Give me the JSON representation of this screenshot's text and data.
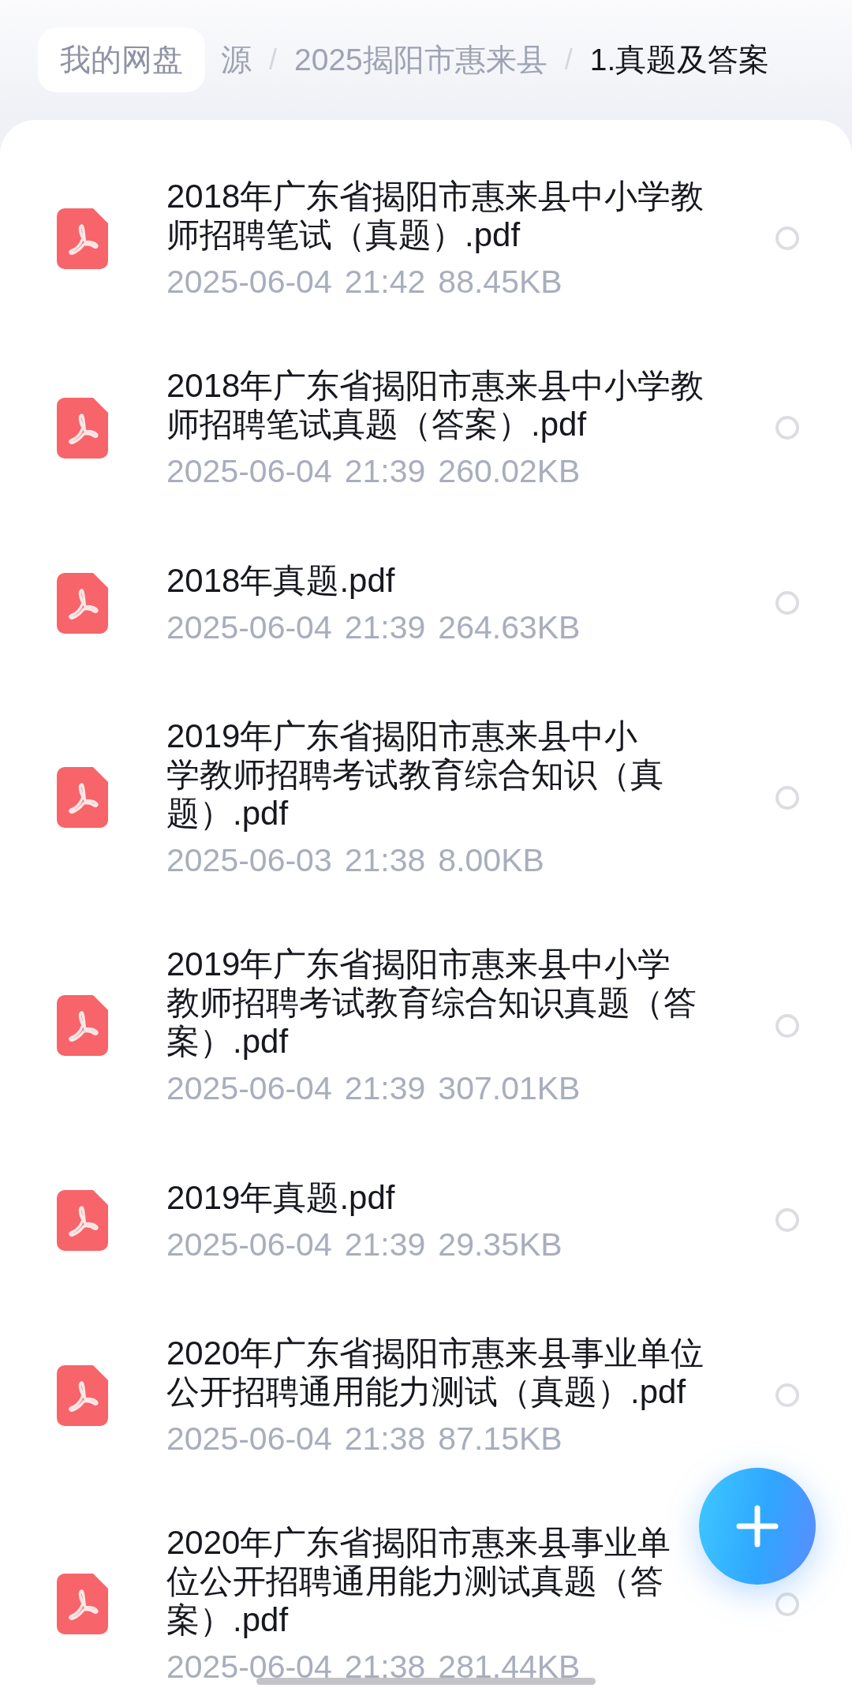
{
  "breadcrumb": [
    {
      "label": "我的网盘",
      "kind": "chip"
    },
    {
      "label": "源",
      "kind": "crumb"
    },
    {
      "label": "/",
      "kind": "separator"
    },
    {
      "label": "2025揭阳市惠来县",
      "kind": "crumb"
    },
    {
      "label": "/",
      "kind": "separator"
    },
    {
      "label": "1.真题及答案",
      "kind": "current"
    }
  ],
  "files": [
    {
      "title": [
        "2018年广东省揭阳市惠来县中小学教",
        "师招聘笔试（真题）.pdf"
      ],
      "date": "2025-06-04",
      "time": "21:42",
      "size": "88.45KB",
      "selected": false
    },
    {
      "title": [
        "2018年广东省揭阳市惠来县中小学教",
        "师招聘笔试真题（答案）.pdf"
      ],
      "date": "2025-06-04",
      "time": "21:39",
      "size": "260.02KB",
      "selected": false
    },
    {
      "title": [
        "2018年真题.pdf"
      ],
      "date": "2025-06-04",
      "time": "21:39",
      "size": "264.63KB",
      "selected": false
    },
    {
      "title": [
        "2019年广东省揭阳市惠来县中小",
        "学教师招聘考试教育综合知识（真",
        "题）.pdf"
      ],
      "date": "2025-06-03",
      "time": "21:38",
      "size": "8.00KB",
      "selected": false
    },
    {
      "title": [
        "2019年广东省揭阳市惠来县中小学",
        "教师招聘考试教育综合知识真题（答",
        "案）.pdf"
      ],
      "date": "2025-06-04",
      "time": "21:39",
      "size": "307.01KB",
      "selected": false
    },
    {
      "title": [
        "2019年真题.pdf"
      ],
      "date": "2025-06-04",
      "time": "21:39",
      "size": "29.35KB",
      "selected": false
    },
    {
      "title": [
        "2020年广东省揭阳市惠来县事业单位",
        "公开招聘通用能力测试（真题）.pdf"
      ],
      "date": "2025-06-04",
      "time": "21:38",
      "size": "87.15KB",
      "selected": false
    },
    {
      "title": [
        "2020年广东省揭阳市惠来县事业单",
        "位公开招聘通用能力测试真题（答",
        "案）.pdf"
      ],
      "date": "2025-06-04",
      "time": "21:38",
      "size": "281.44KB",
      "selected": false
    }
  ]
}
